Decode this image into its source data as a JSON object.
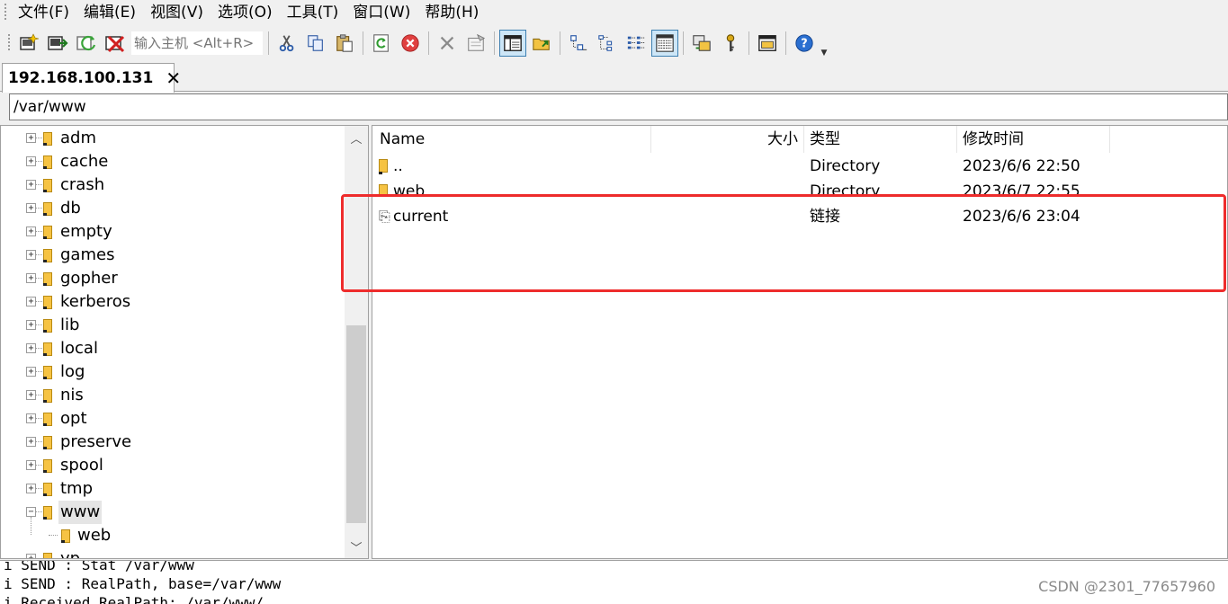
{
  "menu": [
    "文件(F)",
    "编辑(E)",
    "视图(V)",
    "选项(O)",
    "工具(T)",
    "窗口(W)",
    "帮助(H)"
  ],
  "toolbar": {
    "host_placeholder": "输入主机 <Alt+R>",
    "icons": [
      "new-session-icon",
      "connect-icon",
      "reconnect-icon",
      "disconnect-icon",
      "cut-icon",
      "copy-icon",
      "paste-icon",
      "refresh-icon",
      "stop-icon",
      "delete-icon",
      "properties-icon",
      "split-view-icon",
      "upload-folder-icon",
      "large-icons-icon",
      "small-icons-icon",
      "list-view-icon",
      "details-view-icon",
      "sync-icon",
      "key-icon",
      "session-manager-icon",
      "help-icon"
    ]
  },
  "tab": {
    "label": "192.168.100.131",
    "close": "✕"
  },
  "path": "/var/www",
  "tree": {
    "items": [
      {
        "label": "adm",
        "expanded": false
      },
      {
        "label": "cache",
        "expanded": false
      },
      {
        "label": "crash",
        "expanded": false
      },
      {
        "label": "db",
        "expanded": false
      },
      {
        "label": "empty",
        "expanded": false
      },
      {
        "label": "games",
        "expanded": false
      },
      {
        "label": "gopher",
        "expanded": false
      },
      {
        "label": "kerberos",
        "expanded": false
      },
      {
        "label": "lib",
        "expanded": false
      },
      {
        "label": "local",
        "expanded": false
      },
      {
        "label": "log",
        "expanded": false
      },
      {
        "label": "nis",
        "expanded": false
      },
      {
        "label": "opt",
        "expanded": false
      },
      {
        "label": "preserve",
        "expanded": false
      },
      {
        "label": "spool",
        "expanded": false
      },
      {
        "label": "tmp",
        "expanded": false
      },
      {
        "label": "www",
        "expanded": true
      }
    ],
    "child": "web",
    "partial": "yp"
  },
  "files": {
    "columns": {
      "name": "Name",
      "size": "大小",
      "type": "类型",
      "modified": "修改时间"
    },
    "rows": [
      {
        "name": "..",
        "size": "",
        "type": "Directory",
        "modified": "2023/6/6 22:50",
        "kind": "folder"
      },
      {
        "name": "web",
        "size": "",
        "type": "Directory",
        "modified": "2023/6/7 22:55",
        "kind": "folder"
      },
      {
        "name": "current",
        "size": "",
        "type": "链接",
        "modified": "2023/6/6 23:04",
        "kind": "link"
      }
    ]
  },
  "log": [
    "i SEND : Stat /var/www",
    "i SEND : RealPath, base=/var/www",
    "i Received RealPath: /var/www/"
  ],
  "watermark": "CSDN @2301_77657960",
  "colors": {
    "highlight": "#ee2c2c",
    "folder": "#f6c343",
    "selected": "#e5e5e5"
  }
}
